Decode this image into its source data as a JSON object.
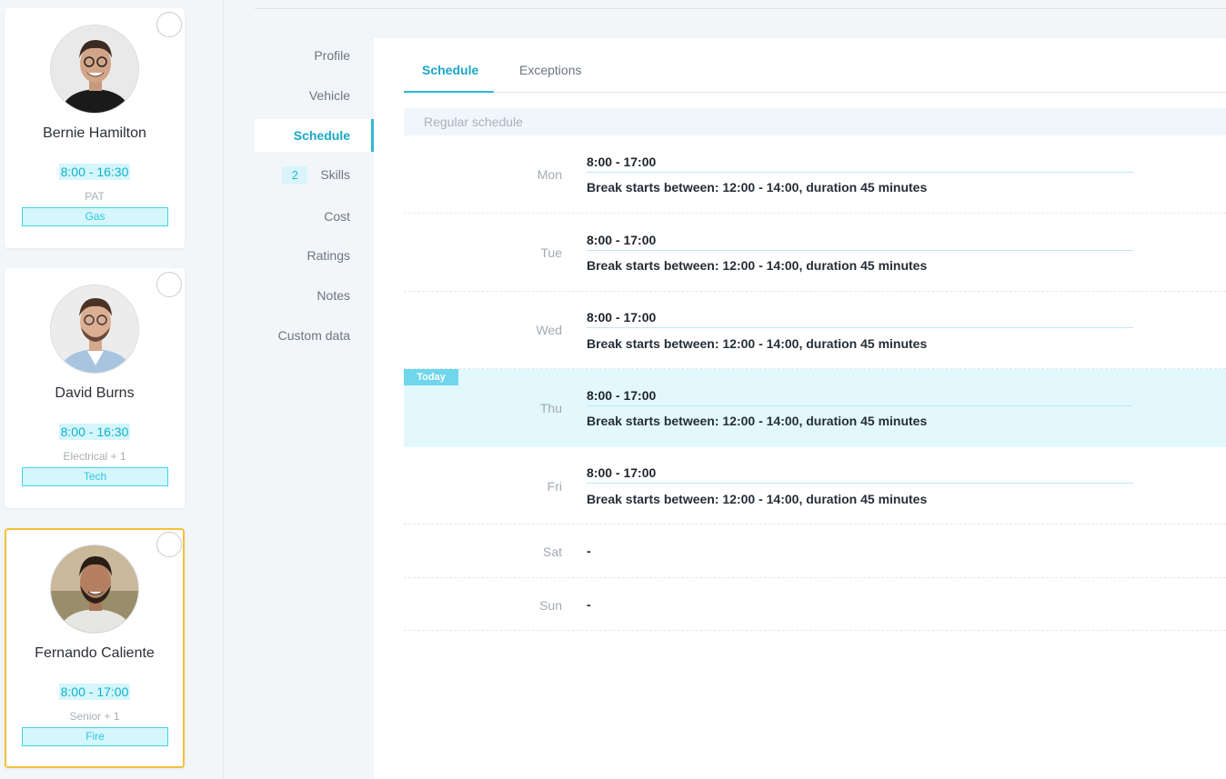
{
  "technicians": [
    {
      "name": "Bernie Hamilton",
      "hours": "8:00 - 16:30",
      "skill": "PAT",
      "tag": "Gas"
    },
    {
      "name": "David Burns",
      "hours": "8:00 - 16:30",
      "skill": "Electrical + 1",
      "tag": "Tech"
    },
    {
      "name": "Fernando Caliente",
      "hours": "8:00 - 17:00",
      "skill": "Senior + 1",
      "tag": "Fire"
    }
  ],
  "nav": {
    "profile": "Profile",
    "vehicle": "Vehicle",
    "schedule": "Schedule",
    "skills_count": "2",
    "skills": "Skills",
    "cost": "Cost",
    "ratings": "Ratings",
    "notes": "Notes",
    "custom_data": "Custom data"
  },
  "tabs": {
    "schedule": "Schedule",
    "exceptions": "Exceptions"
  },
  "section_title": "Regular schedule",
  "today_label": "Today",
  "schedule": [
    {
      "day": "Mon",
      "time": "8:00 - 17:00",
      "break": "Break starts between: 12:00 - 14:00, duration 45 minutes"
    },
    {
      "day": "Tue",
      "time": "8:00 - 17:00",
      "break": "Break starts between: 12:00 - 14:00, duration 45 minutes"
    },
    {
      "day": "Wed",
      "time": "8:00 - 17:00",
      "break": "Break starts between: 12:00 - 14:00, duration 45 minutes"
    },
    {
      "day": "Thu",
      "time": "8:00 - 17:00",
      "break": "Break starts between: 12:00 - 14:00, duration 45 minutes"
    },
    {
      "day": "Fri",
      "time": "8:00 - 17:00",
      "break": "Break starts between: 12:00 - 14:00, duration 45 minutes"
    },
    {
      "day": "Sat",
      "time": "-"
    },
    {
      "day": "Sun",
      "time": "-"
    }
  ],
  "colors": {
    "accent": "#1aa7c9",
    "today_bg": "#e3f8fc",
    "selected_border": "#f5c13b"
  }
}
